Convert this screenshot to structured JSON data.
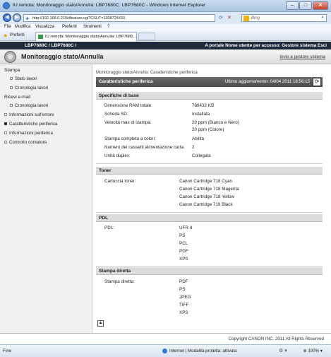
{
  "window": {
    "title": "IU remota: Monitoraggio stato/Annulla: LBP7680C: LBP7680C - Windows Internet Explorer",
    "min": "–",
    "max": "□",
    "close": "✕"
  },
  "address": {
    "url": "http://192.168.0.215/dfeature.cgi?CSUT=1308724433",
    "search_placeholder": "Bing"
  },
  "menu": [
    "File",
    "Modifica",
    "Visualizza",
    "Preferiti",
    "Strumenti",
    "?"
  ],
  "favorites": {
    "label": "Preferiti",
    "tab_title": "IU remota: Monitoraggio stato/Annulla: LBP7680..."
  },
  "product_bar": {
    "model": "LBP7680C / LBP7680C /",
    "right": "A portale   Nome utente per accesso: Gestore sistema Esci"
  },
  "page_header": {
    "title": "Monitoraggio stato/Annulla",
    "link": "Invio a gestore sistema"
  },
  "sidebar": {
    "stampa": "Stampa",
    "stato_lavori": "Stato lavori",
    "cronologia_lavori": "Cronologia lavori",
    "ricevi_email": "Ricevi e-mail",
    "cronologia_lavori_2": "Cronologia lavori",
    "info_errore": "Informazioni sull'errore",
    "caratteristiche": "Caratteristiche periferica",
    "info_periferica": "Informazioni periferica",
    "controllo": "Controllo contatore"
  },
  "content": {
    "breadcrumb": "Monitoraggio stato/Annulla: Caratteristiche periferica",
    "title": "Caratteristiche periferica",
    "updated": "Ultimo aggiornamento: 04/04 2011 18:56:15",
    "base": {
      "header": "Specifiche di base",
      "ram_label": "Dimensione RAM totale:",
      "ram_value": "786432 KB",
      "sd_label": "Scheda SD:",
      "sd_value": "Installata",
      "speed_label": "Velocità max di stampa:",
      "speed_value_1": "20 ppm (Bianco e Nero)",
      "speed_value_2": "20 ppm (Colore)",
      "color_label": "Stampa completa a colori:",
      "color_value": "Abilita",
      "trays_label": "Numero dei cassetti alimentazione carta:",
      "trays_value": "2",
      "duplex_label": "Unità duplex:",
      "duplex_value": "Collegata"
    },
    "toner": {
      "header": "Toner",
      "label": "Cartuccia toner:",
      "items": [
        "Canon Cartridge 718 Cyan",
        "Canon Cartridge 718 Magenta",
        "Canon Cartridge 718 Yellow",
        "Canon Cartridge 718 Black"
      ]
    },
    "pdl": {
      "header": "PDL",
      "label": "PDL:",
      "items": [
        "UFR II",
        "PS",
        "PCL",
        "PDF",
        "XPS"
      ]
    },
    "direct": {
      "header": "Stampa diretta",
      "label": "Stampa diretta:",
      "items": [
        "PDF",
        "PS",
        "JPEG",
        "TIFF",
        "XPS"
      ]
    }
  },
  "copyright": "Copyright CANON INC. 2011 All Rights Reserved",
  "status": {
    "text": "Fine",
    "zone": "Internet | Modalità protetta: attivata",
    "zoom": "100%"
  }
}
